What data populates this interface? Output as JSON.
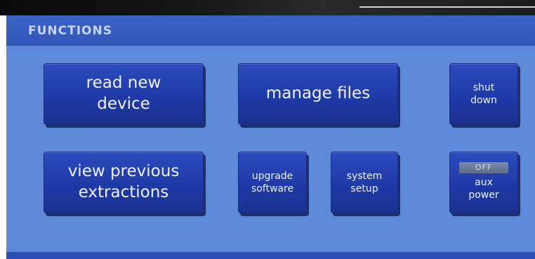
{
  "panel": {
    "title": "FUNCTIONS"
  },
  "buttons": {
    "read_new_device": "read new\ndevice",
    "manage_files": "manage files",
    "shut_down": "shut\ndown",
    "view_previous_extractions": "view previous\nextractions",
    "upgrade_software": "upgrade\nsoftware",
    "system_setup": "system\nsetup",
    "aux_power": {
      "status": "OFF",
      "label": "aux\npower"
    }
  },
  "colors": {
    "panel_background": "#5c8ad8",
    "header_background": "#3b63c6",
    "button_fill": "#2c4bbd",
    "button_text": "#eef2fb",
    "title_text": "#c7d6f4"
  }
}
